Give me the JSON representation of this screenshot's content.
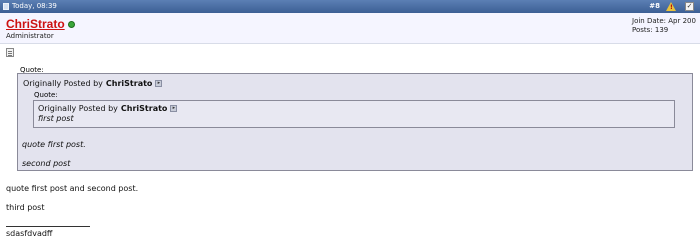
{
  "header": {
    "date": "Today, 08:39",
    "post_number": "#8"
  },
  "user": {
    "name": "ChriStrato",
    "role": "Administrator",
    "join_date": "Join Date: Apr 200",
    "posts": "Posts: 139"
  },
  "post": {
    "outer_quote": {
      "label": "Quote:",
      "originally_prefix": "Originally Posted by",
      "author": "ChriStrato",
      "inner_quote": {
        "label": "Quote:",
        "originally_prefix": "Originally Posted by",
        "author": "ChriStrato",
        "text": "first post"
      },
      "lines": [
        "quote first post.",
        "second post"
      ]
    },
    "lines": [
      "quote first post and second post.",
      "third post"
    ],
    "signature": "sdasfdvadff"
  }
}
